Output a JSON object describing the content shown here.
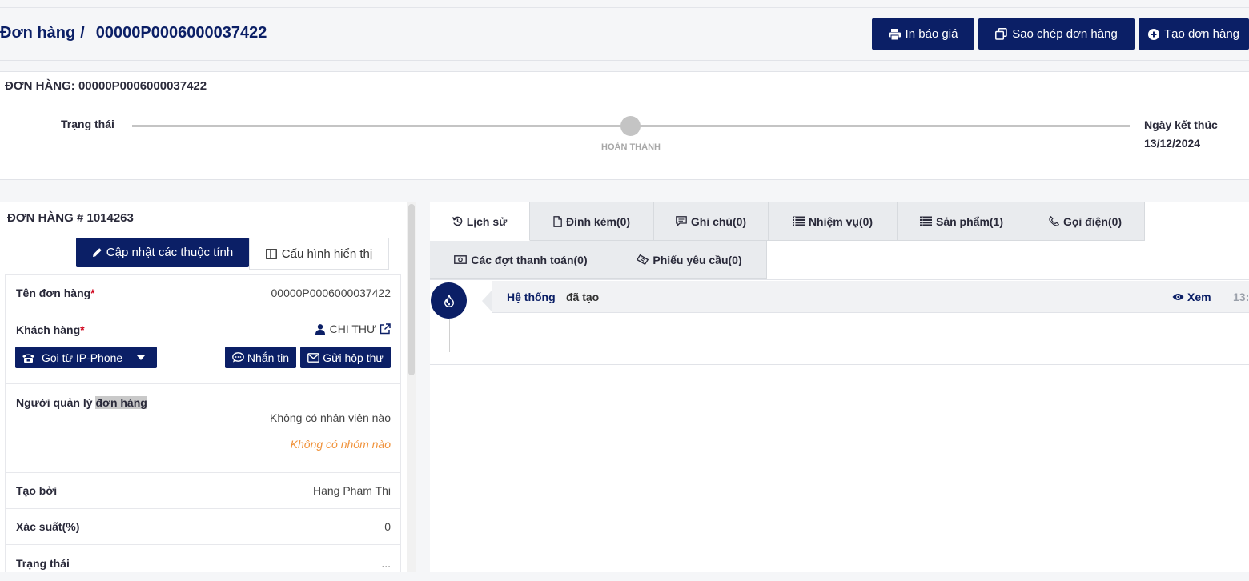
{
  "header": {
    "breadcrumb_root": "Đơn hàng",
    "breadcrumb_sep": "/",
    "order_code": "00000P0006000037422",
    "buttons": {
      "print_quote": "In báo giá",
      "copy_order": "Sao chép đơn hàng",
      "create_order": "Tạo đơn hàng"
    }
  },
  "status_card": {
    "title": "ĐƠN HÀNG: 00000P0006000037422",
    "status_label": "Trạng thái",
    "stage": "HOÀN THÀNH",
    "end_date": "Ngày kết thúc 13/12/2024"
  },
  "left_panel": {
    "title": "ĐƠN HÀNG # 1014263",
    "update_button": "Cập nhật các thuộc tính",
    "config_button": "Cấu hình hiển thị",
    "fields": {
      "order_name_label": "Tên đơn hàng",
      "order_name_value": "00000P0006000037422",
      "customer_label": "Khách hàng",
      "customer_value": "CHI THƯ",
      "call_button": "Gọi từ IP-Phone",
      "message_button": "Nhắn tin",
      "mail_button": "Gửi hộp thư",
      "manager_label_a": "Người quản lý",
      "manager_label_b": "đơn hàng",
      "no_staff": "Không có nhân viên nào",
      "no_group": "Không có nhóm nào",
      "created_by_label": "Tạo bởi",
      "created_by_value": "Hang Pham Thi",
      "probability_label": "Xác suất(%)",
      "probability_value": "0",
      "status_label": "Trạng thái",
      "status_value": "..."
    },
    "required_mark": "*"
  },
  "tabs": [
    {
      "label": "Lịch sử"
    },
    {
      "label": "Đính kèm(0)"
    },
    {
      "label": "Ghi chú(0)"
    },
    {
      "label": "Nhiệm vụ(0)"
    },
    {
      "label": "Sản phẩm(1)"
    },
    {
      "label": "Gọi điện(0)"
    },
    {
      "label": "Các đợt thanh toán(0)"
    },
    {
      "label": "Phiếu yêu cầu(0)"
    }
  ],
  "timeline": {
    "actor": "Hệ thống",
    "action": "đã tạo",
    "view_label": "Xem",
    "time": "13:"
  },
  "colors": {
    "primary": "#0b1f66",
    "track": "#c4c4c4",
    "warning": "#f0923a",
    "required": "#d0021b"
  }
}
